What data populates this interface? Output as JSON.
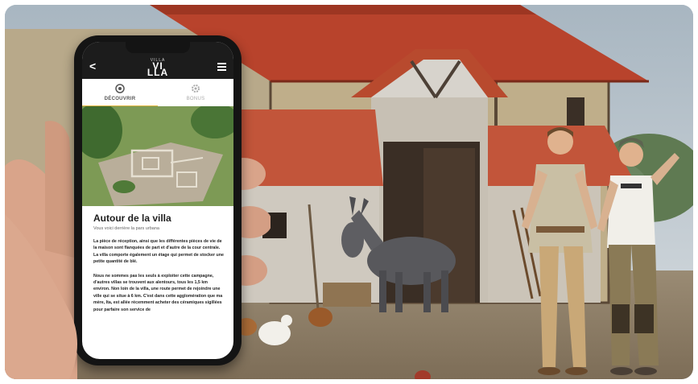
{
  "app": {
    "logo_small": "VILLA",
    "logo_main": "VI\nLLA"
  },
  "tabs": [
    {
      "label": "DÉCOUVRIR",
      "icon": "discover-icon",
      "active": true
    },
    {
      "label": "BONUS",
      "icon": "gear-icon",
      "active": false
    }
  ],
  "article": {
    "title": "Autour de la villa",
    "subtitle": "Vous voici derrière la pars urbana",
    "paragraph1": "La pièce de réception, ainsi que les différentes pièces de vie de la maison sont flanquées de part et d'autre de la cour centrale. La villa comporte également un étage qui permet de stocker une petite quantité de blé.",
    "paragraph2": "Nous ne sommes pas les seuls à exploiter cette campagne, d'autres villas se trouvent aux alentours, tous les 1,5 km environ. Non loin de la villa, une route permet de rejoindre une ville qui se situe à 6 km. C'est dans cette agglomération que ma mère, Ita, est allée récemment acheter des céramiques sigillées pour parfaire son service de"
  },
  "colors": {
    "accent": "#e2b640",
    "appbar": "#1c1c1c",
    "roof": "#b8432c",
    "sky": "#a9b8c2"
  }
}
